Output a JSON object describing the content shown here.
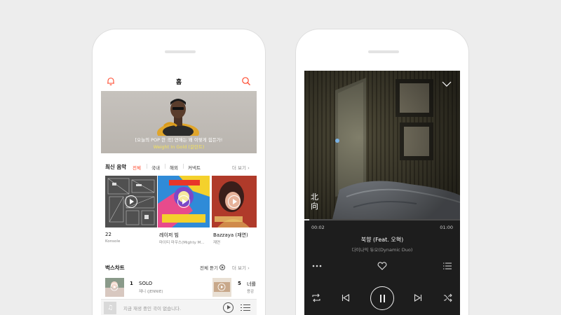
{
  "home": {
    "title": "홈",
    "banner": {
      "line1": "[오늘의 POP 한 곡] 연애는 왜 이렇게 힘든가!",
      "line2": "Weight In Gold (갈란트)"
    },
    "latest": {
      "title": "최신 음악",
      "tabs": [
        "전체",
        "국내",
        "해외",
        "커넥트"
      ],
      "active_tab": 0,
      "more": "더 보기",
      "albums": [
        {
          "title": "22",
          "artist": "Konsole"
        },
        {
          "title": "레이저 빔",
          "artist": "마이티 마우스(Mighty M..."
        },
        {
          "title": "Bazzaya (재연)",
          "artist": "재연"
        }
      ]
    },
    "chart": {
      "title": "벅스차트",
      "play_all": "전체 듣기",
      "more": "더 보기",
      "rows": [
        {
          "rank": "1",
          "song": "SOLO",
          "artist": "제니 (JENNIE)"
        },
        {
          "rank": "5",
          "song": "너를",
          "artist": "용감"
        }
      ]
    },
    "mini_player": {
      "text": "지금 재생 중인 곡이 없습니다."
    }
  },
  "player": {
    "time_current": "00:02",
    "time_total": "01:00",
    "progress": 0.033,
    "title": "북향 (Feat. 오혁)",
    "artist": "다이나믹 듀오(Dynamic Duo)",
    "art_text": "北向"
  },
  "colors": {
    "accent": "#ff4a2e",
    "player_bg": "#1d1d1d"
  }
}
